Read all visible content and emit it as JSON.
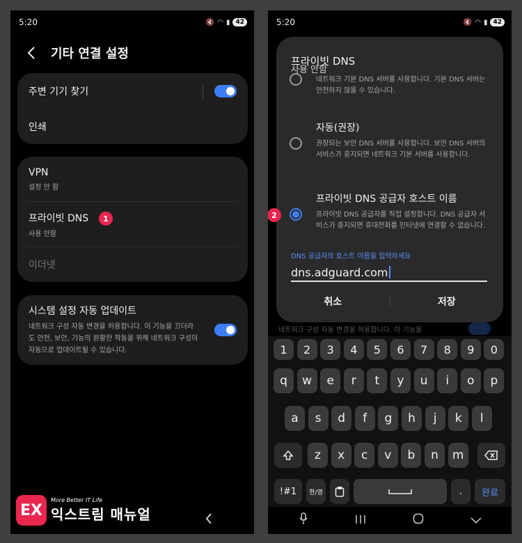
{
  "left": {
    "status": {
      "time": "5:20",
      "battery": "42"
    },
    "header": {
      "title": "기타 연결 설정"
    },
    "card1": {
      "nearby": "주변 기기 찾기",
      "print": "인쇄"
    },
    "card2": {
      "vpn_title": "VPN",
      "vpn_sub": "설정 안 함",
      "dns_title": "프라이빗 DNS",
      "dns_sub": "사용 안함",
      "ethernet": "이더넷"
    },
    "card3": {
      "title": "시스템 설정 자동 업데이트",
      "desc": "네트워크 구성 자동 변경을 허용합니다. 이 기능을 끄더라도 안전, 보안, 기능의 원활한 작동을 위해 네트워크 구성이 자동으로 업데이트될 수 있습니다."
    },
    "badge": "1"
  },
  "logo": {
    "small": "More Better IT Life",
    "big": "익스트림 매뉴얼",
    "mark": "EX"
  },
  "right": {
    "status": {
      "time": "5:20",
      "battery": "42"
    },
    "background_text": "네트워크 구성 자동 변경을 허용합니다. 이 기능을",
    "dialog": {
      "title": "프라이빗 DNS",
      "opt1_title": "사용 안함",
      "opt1_desc": "네트워크 기본 DNS 서버를 사용합니다. 기본 DNS 서버는 안전하지 않을 수 있습니다.",
      "opt2_title": "자동(권장)",
      "opt2_desc": "권장되는 보안 DNS 서버를 사용합니다. 보안 DNS 서버의 서비스가 중지되면 네트워크 기본 서버를 사용합니다.",
      "opt3_title": "프라이빗 DNS 공급자 호스트 이름",
      "opt3_desc": "프라이빗 DNS 공급자를 직접 설정합니다. DNS 공급자 서비스가 중지되면 휴대전화를 인터넷에 연결할 수 없습니다.",
      "field_label": "DNS 공급자의 호스트 이름을 입력하세요",
      "field_value": "dns.adguard.com",
      "cancel": "취소",
      "save": "저장"
    },
    "badge": "2",
    "keyboard": {
      "numbers": [
        "1",
        "2",
        "3",
        "4",
        "5",
        "6",
        "7",
        "8",
        "9",
        "0"
      ],
      "row1": [
        "q",
        "w",
        "e",
        "r",
        "t",
        "y",
        "u",
        "i",
        "o",
        "p"
      ],
      "row2": [
        "a",
        "s",
        "d",
        "f",
        "g",
        "h",
        "j",
        "k",
        "l"
      ],
      "row3": [
        "z",
        "x",
        "c",
        "v",
        "b",
        "n",
        "m"
      ],
      "sym": "!#1",
      "lang": "한/영",
      "period": ".",
      "done": "완료"
    }
  }
}
